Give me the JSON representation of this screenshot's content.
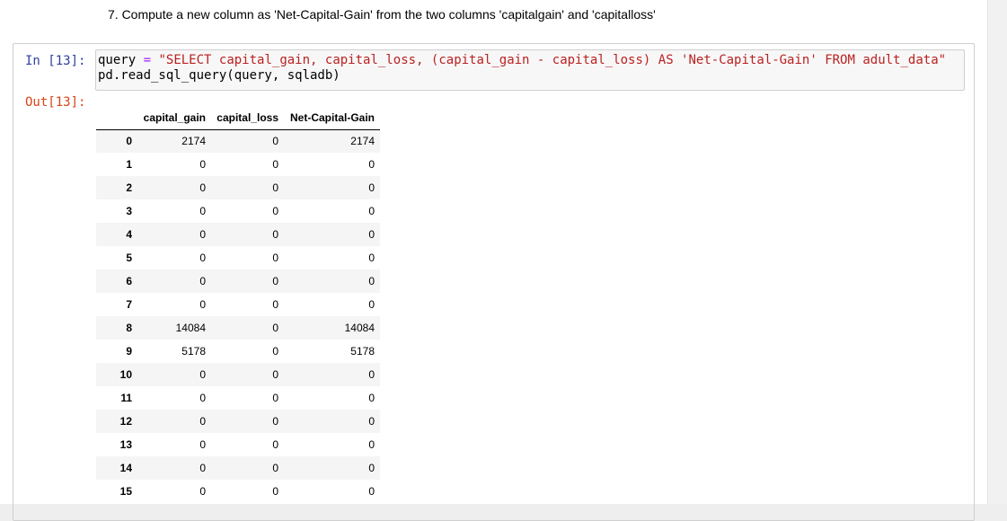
{
  "markdown": {
    "text": "7. Compute a new column as 'Net-Capital-Gain' from the two columns 'capitalgain' and 'capitalloss'"
  },
  "cell": {
    "in_prompt": "In [13]:",
    "out_prompt": "Out[13]:",
    "code": {
      "line1_var": "query",
      "line1_op": "=",
      "line1_str": "\"SELECT capital_gain, capital_loss, (capital_gain - capital_loss) AS 'Net-Capital-Gain' FROM adult_data\"",
      "line2": "pd.read_sql_query(query, sqladb)"
    }
  },
  "table": {
    "columns": [
      "capital_gain",
      "capital_loss",
      "Net-Capital-Gain"
    ],
    "rows": [
      {
        "index": "0",
        "values": [
          "2174",
          "0",
          "2174"
        ]
      },
      {
        "index": "1",
        "values": [
          "0",
          "0",
          "0"
        ]
      },
      {
        "index": "2",
        "values": [
          "0",
          "0",
          "0"
        ]
      },
      {
        "index": "3",
        "values": [
          "0",
          "0",
          "0"
        ]
      },
      {
        "index": "4",
        "values": [
          "0",
          "0",
          "0"
        ]
      },
      {
        "index": "5",
        "values": [
          "0",
          "0",
          "0"
        ]
      },
      {
        "index": "6",
        "values": [
          "0",
          "0",
          "0"
        ]
      },
      {
        "index": "7",
        "values": [
          "0",
          "0",
          "0"
        ]
      },
      {
        "index": "8",
        "values": [
          "14084",
          "0",
          "14084"
        ]
      },
      {
        "index": "9",
        "values": [
          "5178",
          "0",
          "5178"
        ]
      },
      {
        "index": "10",
        "values": [
          "0",
          "0",
          "0"
        ]
      },
      {
        "index": "11",
        "values": [
          "0",
          "0",
          "0"
        ]
      },
      {
        "index": "12",
        "values": [
          "0",
          "0",
          "0"
        ]
      },
      {
        "index": "13",
        "values": [
          "0",
          "0",
          "0"
        ]
      },
      {
        "index": "14",
        "values": [
          "0",
          "0",
          "0"
        ]
      },
      {
        "index": "15",
        "values": [
          "0",
          "0",
          "0"
        ]
      }
    ]
  }
}
